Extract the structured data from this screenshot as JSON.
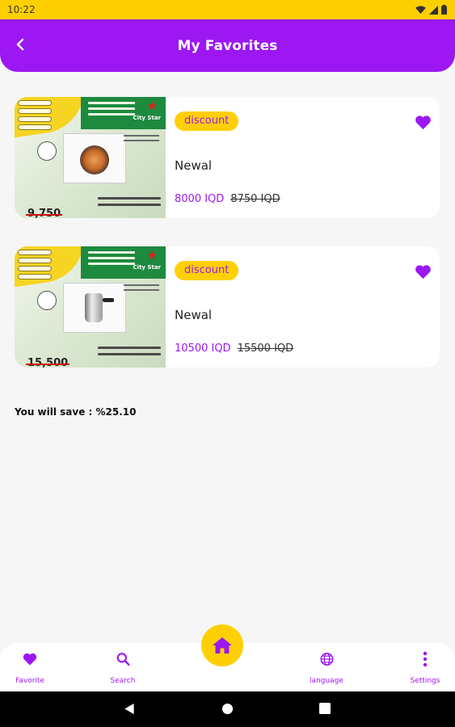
{
  "status_bar": {
    "time": "10:22",
    "icons": [
      "wifi-icon",
      "signal-icon",
      "battery-icon"
    ]
  },
  "header": {
    "title": "My Favorites",
    "back_icon": "chevron-left-icon"
  },
  "favorites": [
    {
      "badge": "discount",
      "name": "Newal",
      "price": "8000 IQD",
      "old_price": "8750 IQD",
      "image_old_price": "9,750",
      "favorite_icon": "heart-icon"
    },
    {
      "badge": "discount",
      "name": "Newal",
      "price": "10500 IQD",
      "old_price": "15500 IQD",
      "image_old_price": "15,500",
      "favorite_icon": "heart-icon"
    }
  ],
  "savings": "You will save : %25.10",
  "bottom_nav": {
    "items": [
      {
        "label": "Favorite",
        "icon": "heart-icon"
      },
      {
        "label": "Search",
        "icon": "search-icon"
      },
      {
        "label": "language",
        "icon": "globe-icon"
      },
      {
        "label": "Settings",
        "icon": "more-vertical-icon"
      }
    ],
    "home_icon": "home-icon"
  },
  "colors": {
    "accent": "#9d17f2",
    "yellow": "#ffd000",
    "background": "#f6f6f6"
  }
}
